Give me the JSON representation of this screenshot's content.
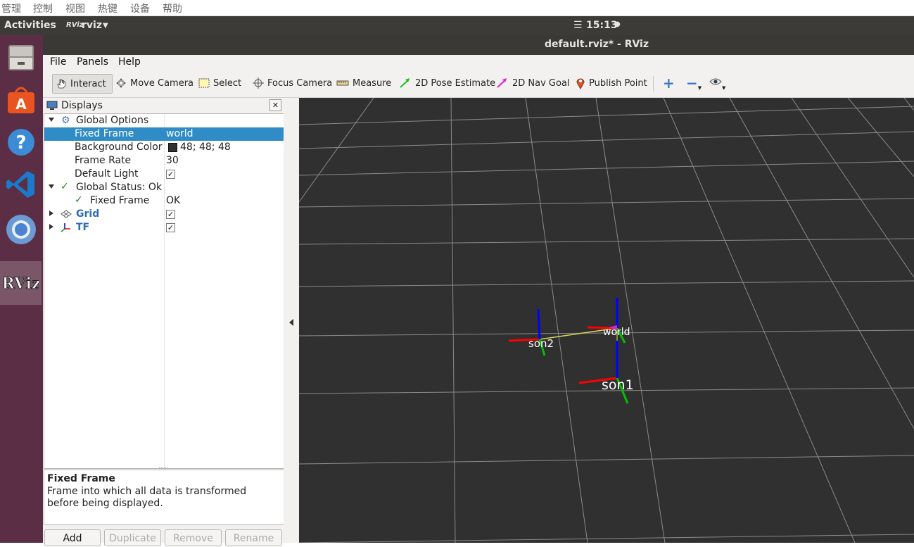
{
  "host_menu": [
    "管理",
    "控制",
    "视图",
    "热键",
    "设备",
    "帮助"
  ],
  "topbar": {
    "activities": "Activities",
    "app_name": "rviz",
    "clock": "15:13"
  },
  "dock": [
    "files-icon",
    "software-center-icon",
    "help-icon",
    "vscode-icon",
    "chromium-icon",
    "rviz-icon"
  ],
  "window": {
    "title": "default.rviz* - RViz"
  },
  "menu": {
    "file": "File",
    "panels": "Panels",
    "help": "Help"
  },
  "toolbar": {
    "interact": "Interact",
    "move_camera": "Move Camera",
    "select": "Select",
    "focus_camera": "Focus Camera",
    "measure": "Measure",
    "pose_estimate": "2D Pose Estimate",
    "nav_goal": "2D Nav Goal",
    "publish_point": "Publish Point"
  },
  "displays": {
    "title": "Displays",
    "global_options": "Global Options",
    "fixed_frame_label": "Fixed Frame",
    "fixed_frame_value": "world",
    "bg_color_label": "Background Color",
    "bg_color_value": "48; 48; 48",
    "bg_color_swatch": "#303030",
    "frame_rate_label": "Frame Rate",
    "frame_rate_value": "30",
    "default_light_label": "Default Light",
    "global_status": "Global Status: Ok",
    "status_fixed_frame": "Fixed Frame",
    "status_fixed_frame_value": "OK",
    "grid": "Grid",
    "tf": "TF",
    "check": "✓"
  },
  "description": {
    "title": "Fixed Frame",
    "text": "Frame into which all data is transformed before being displayed."
  },
  "buttons": {
    "add": "Add",
    "duplicate": "Duplicate",
    "remove": "Remove",
    "rename": "Rename"
  },
  "scene": {
    "frames": [
      {
        "label": "son2"
      },
      {
        "label": "world"
      },
      {
        "label": "son1"
      }
    ],
    "colors": {
      "background": "#303030",
      "grid": "#a0a0a0",
      "x_axis": "#ff0000",
      "y_axis": "#00c000",
      "z_axis": "#0000ff"
    }
  }
}
